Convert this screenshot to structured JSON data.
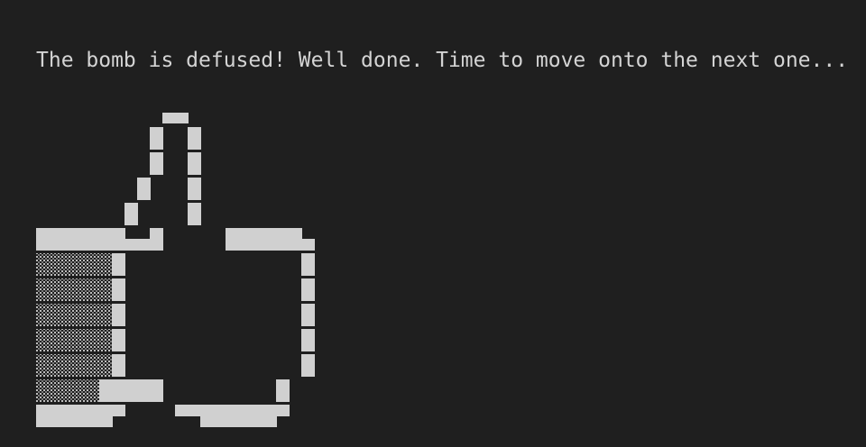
{
  "terminal": {
    "message": "The bomb is defused! Well done. Time to move onto the next one...",
    "art": {
      "name": "thumbs-up-ascii-art",
      "fg_color": "#d0d0d0",
      "bg_color": "#1f1f1f"
    }
  }
}
